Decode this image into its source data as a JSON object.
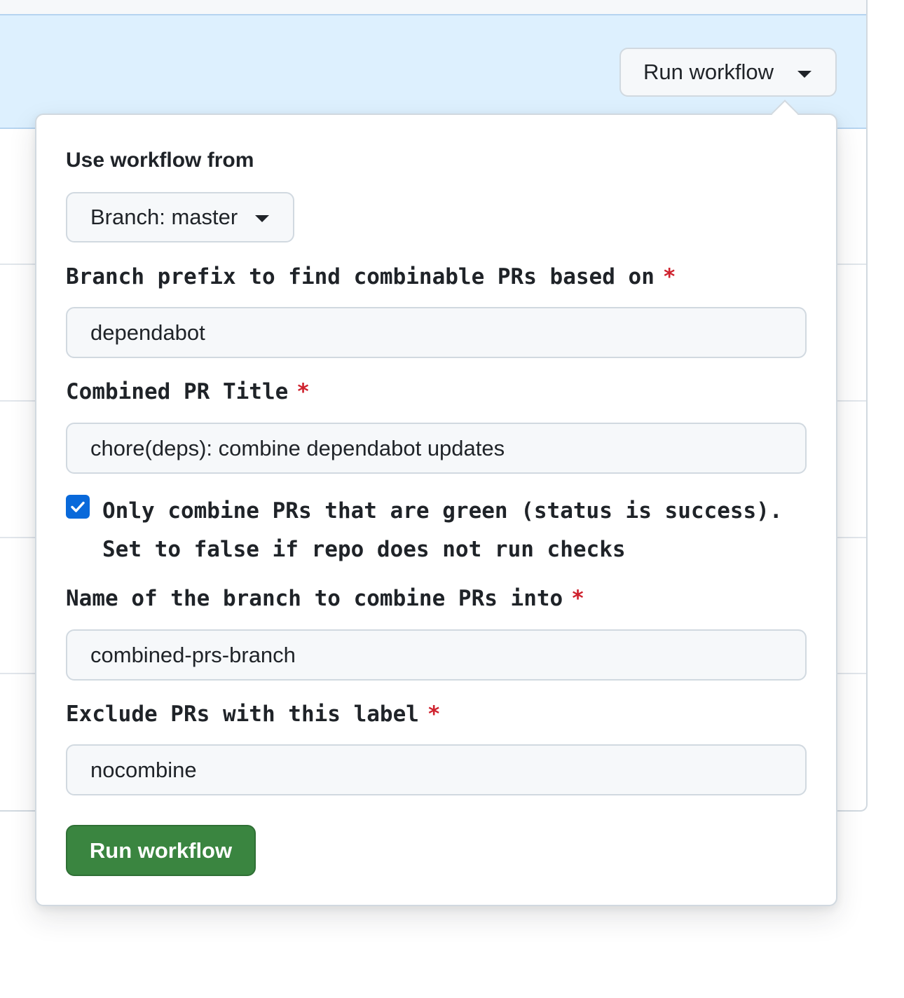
{
  "header": {
    "run_workflow_dropdown_label": "Run workflow"
  },
  "popover": {
    "section_title": "Use workflow from",
    "branch_select_label": "Branch: master",
    "fields": [
      {
        "label": "Branch prefix to find combinable PRs based on",
        "required_mark": "*",
        "value": "dependabot"
      },
      {
        "label": "Combined PR Title",
        "required_mark": "*",
        "value": "chore(deps): combine dependabot updates"
      },
      {
        "label": "Name of the branch to combine PRs into",
        "required_mark": "*",
        "value": "combined-prs-branch"
      },
      {
        "label": "Exclude PRs with this label",
        "required_mark": "*",
        "value": "nocombine"
      }
    ],
    "checkbox": {
      "checked": true,
      "label_line1": "Only combine PRs that are green (status is success).",
      "label_line2": "Set to false if repo does not run checks"
    },
    "submit_label": "Run workflow"
  },
  "colors": {
    "banner_bg": "#ddf0fe",
    "required": "#cf222e",
    "primary_button": "#3a8540",
    "checkbox": "#0969da"
  }
}
